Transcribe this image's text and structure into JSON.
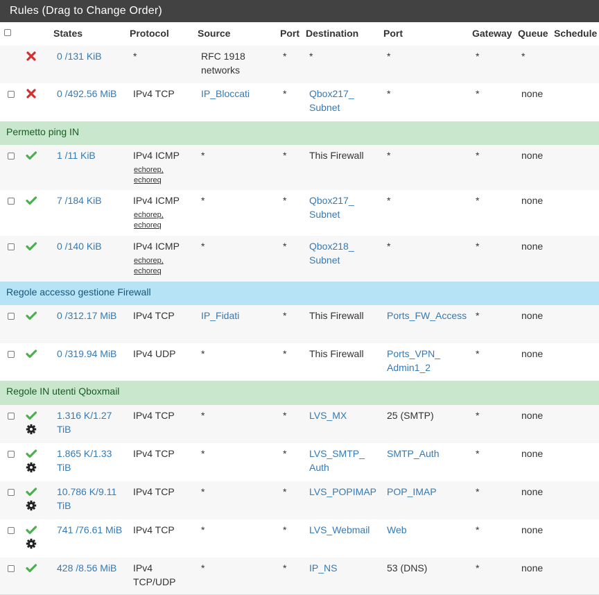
{
  "panel": {
    "title": "Rules (Drag to Change Order)"
  },
  "columns": {
    "states": "States",
    "protocol": "Protocol",
    "source": "Source",
    "port": "Port",
    "destination": "Destination",
    "dest_port": "Port",
    "gateway": "Gateway",
    "queue": "Queue",
    "schedule": "Schedule"
  },
  "colors": {
    "header_bg": "#424242",
    "link": "#337ab7",
    "pass": "#4caf50",
    "block": "#d32f2f",
    "separator_green": "#c9e7cd",
    "separator_blue": "#b7e3f7"
  },
  "rows": [
    {
      "kind": "rule",
      "checkbox": false,
      "action": "block",
      "advanced": false,
      "states": [
        "0 /131 KiB"
      ],
      "protocol": [
        "*"
      ],
      "icmp": [],
      "source": [
        "RFC 1918",
        "networks"
      ],
      "source_link": false,
      "src_port": "*",
      "destination": [
        "*"
      ],
      "dest_link": false,
      "dest_port": [
        "*"
      ],
      "dest_port_link": false,
      "gateway": "*",
      "queue": "*",
      "schedule": ""
    },
    {
      "kind": "rule",
      "checkbox": true,
      "action": "block",
      "advanced": false,
      "states": [
        "0 /492.56 MiB"
      ],
      "protocol": [
        "IPv4 TCP"
      ],
      "icmp": [],
      "source": [
        "IP_Bloccati"
      ],
      "source_link": true,
      "src_port": "*",
      "destination": [
        "Qbox217_",
        "Subnet"
      ],
      "dest_link": true,
      "dest_port": [
        "*"
      ],
      "dest_port_link": false,
      "gateway": "*",
      "queue": "none",
      "schedule": ""
    },
    {
      "kind": "separator",
      "color": "green",
      "label": "Permetto ping IN"
    },
    {
      "kind": "rule",
      "checkbox": true,
      "action": "pass",
      "advanced": false,
      "states": [
        "1 /11 KiB"
      ],
      "protocol": [
        "IPv4 ICMP"
      ],
      "icmp": [
        "echorep,",
        "echoreq"
      ],
      "source": [
        "*"
      ],
      "source_link": false,
      "src_port": "*",
      "destination": [
        "This Firewall"
      ],
      "dest_link": false,
      "dest_port": [
        "*"
      ],
      "dest_port_link": false,
      "gateway": "*",
      "queue": "none",
      "schedule": ""
    },
    {
      "kind": "rule",
      "checkbox": true,
      "action": "pass",
      "advanced": false,
      "states": [
        "7 /184 KiB"
      ],
      "protocol": [
        "IPv4 ICMP"
      ],
      "icmp": [
        "echorep,",
        "echoreq"
      ],
      "source": [
        "*"
      ],
      "source_link": false,
      "src_port": "*",
      "destination": [
        "Qbox217_",
        "Subnet"
      ],
      "dest_link": true,
      "dest_port": [
        "*"
      ],
      "dest_port_link": false,
      "gateway": "*",
      "queue": "none",
      "schedule": ""
    },
    {
      "kind": "rule",
      "checkbox": true,
      "action": "pass",
      "advanced": false,
      "states": [
        "0 /140 KiB"
      ],
      "protocol": [
        "IPv4 ICMP"
      ],
      "icmp": [
        "echorep,",
        "echoreq"
      ],
      "source": [
        "*"
      ],
      "source_link": false,
      "src_port": "*",
      "destination": [
        "Qbox218_",
        "Subnet"
      ],
      "dest_link": true,
      "dest_port": [
        "*"
      ],
      "dest_port_link": false,
      "gateway": "*",
      "queue": "none",
      "schedule": ""
    },
    {
      "kind": "separator",
      "color": "blue",
      "label": "Regole accesso gestione Firewall"
    },
    {
      "kind": "rule",
      "checkbox": true,
      "action": "pass",
      "advanced": false,
      "states": [
        "0 /312.17 MiB"
      ],
      "protocol": [
        "IPv4 TCP"
      ],
      "icmp": [],
      "source": [
        "IP_Fidati"
      ],
      "source_link": true,
      "src_port": "*",
      "destination": [
        "This Firewall"
      ],
      "dest_link": false,
      "dest_port": [
        "Ports_FW_Access"
      ],
      "dest_port_link": true,
      "gateway": "*",
      "queue": "none",
      "schedule": ""
    },
    {
      "kind": "rule",
      "checkbox": true,
      "action": "pass",
      "advanced": false,
      "states": [
        "0 /319.94 MiB"
      ],
      "protocol": [
        "IPv4 UDP"
      ],
      "icmp": [],
      "source": [
        "*"
      ],
      "source_link": false,
      "src_port": "*",
      "destination": [
        "This Firewall"
      ],
      "dest_link": false,
      "dest_port": [
        "Ports_VPN_",
        "Admin1_2"
      ],
      "dest_port_link": true,
      "gateway": "*",
      "queue": "none",
      "schedule": ""
    },
    {
      "kind": "separator",
      "color": "green",
      "label": "Regole IN utenti Qboxmail"
    },
    {
      "kind": "rule",
      "checkbox": true,
      "action": "pass",
      "advanced": true,
      "states": [
        "1.316 K/1.27",
        "TiB"
      ],
      "protocol": [
        "IPv4 TCP"
      ],
      "icmp": [],
      "source": [
        "*"
      ],
      "source_link": false,
      "src_port": "*",
      "destination": [
        "LVS_MX"
      ],
      "dest_link": true,
      "dest_port": [
        "25 (SMTP)"
      ],
      "dest_port_link": false,
      "gateway": "*",
      "queue": "none",
      "schedule": ""
    },
    {
      "kind": "rule",
      "checkbox": true,
      "action": "pass",
      "advanced": true,
      "states": [
        "1.865 K/1.33",
        "TiB"
      ],
      "protocol": [
        "IPv4 TCP"
      ],
      "icmp": [],
      "source": [
        "*"
      ],
      "source_link": false,
      "src_port": "*",
      "destination": [
        "LVS_SMTP_",
        "Auth"
      ],
      "dest_link": true,
      "dest_port": [
        "SMTP_Auth"
      ],
      "dest_port_link": true,
      "gateway": "*",
      "queue": "none",
      "schedule": ""
    },
    {
      "kind": "rule",
      "checkbox": true,
      "action": "pass",
      "advanced": true,
      "states": [
        "10.786 K/9.11",
        "TiB"
      ],
      "protocol": [
        "IPv4 TCP"
      ],
      "icmp": [],
      "source": [
        "*"
      ],
      "source_link": false,
      "src_port": "*",
      "destination": [
        "LVS_POPIMAP"
      ],
      "dest_link": true,
      "dest_port": [
        "POP_IMAP"
      ],
      "dest_port_link": true,
      "gateway": "*",
      "queue": "none",
      "schedule": ""
    },
    {
      "kind": "rule",
      "checkbox": true,
      "action": "pass",
      "advanced": true,
      "states": [
        "741 /76.61 MiB"
      ],
      "protocol": [
        "IPv4 TCP"
      ],
      "icmp": [],
      "source": [
        "*"
      ],
      "source_link": false,
      "src_port": "*",
      "destination": [
        "LVS_Webmail"
      ],
      "dest_link": true,
      "dest_port": [
        "Web"
      ],
      "dest_port_link": true,
      "gateway": "*",
      "queue": "none",
      "schedule": ""
    },
    {
      "kind": "rule",
      "checkbox": true,
      "action": "pass",
      "advanced": false,
      "states": [
        "428 /8.56 MiB"
      ],
      "protocol": [
        "IPv4",
        "TCP/UDP"
      ],
      "icmp": [],
      "source": [
        "*"
      ],
      "source_link": false,
      "src_port": "*",
      "destination": [
        "IP_NS"
      ],
      "dest_link": true,
      "dest_port": [
        "53 (DNS)"
      ],
      "dest_port_link": false,
      "gateway": "*",
      "queue": "none",
      "schedule": ""
    }
  ]
}
